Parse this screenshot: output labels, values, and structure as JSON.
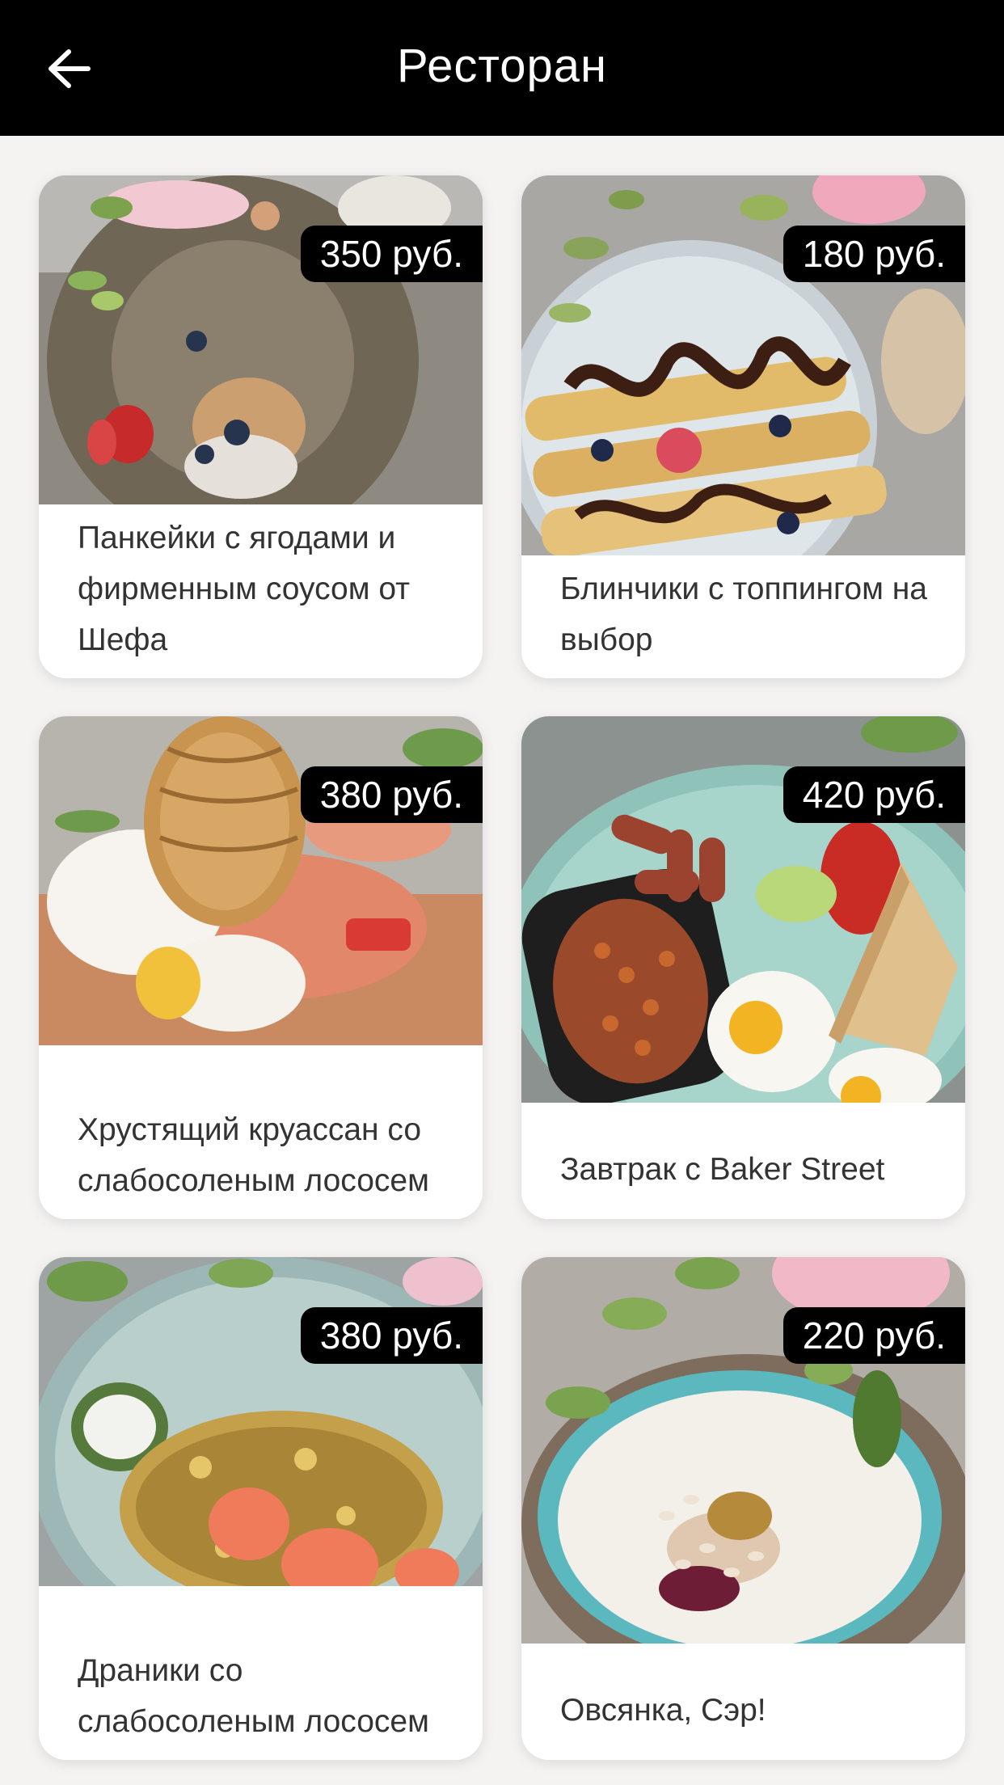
{
  "header": {
    "title": "Ресторан",
    "back_icon": "arrow-left-icon"
  },
  "menu": {
    "items": [
      {
        "name": "Панкейки с ягодами и фирменным соусом от Шефа",
        "price": "350 руб."
      },
      {
        "name": "Блинчики с топпингом на выбор",
        "price": "180 руб."
      },
      {
        "name": "Хрустящий круассан со слабосоленым лососем",
        "price": "380 руб."
      },
      {
        "name": "Завтрак с Baker Street",
        "price": "420 руб."
      },
      {
        "name": "Драники со слабосоленым лососем",
        "price": "380 руб."
      },
      {
        "name": "Овсянка, Сэр!",
        "price": "220 руб."
      }
    ]
  },
  "colors": {
    "header_bg": "#000000",
    "price_badge_bg": "#000000",
    "card_bg": "#ffffff",
    "text": "#333333"
  }
}
